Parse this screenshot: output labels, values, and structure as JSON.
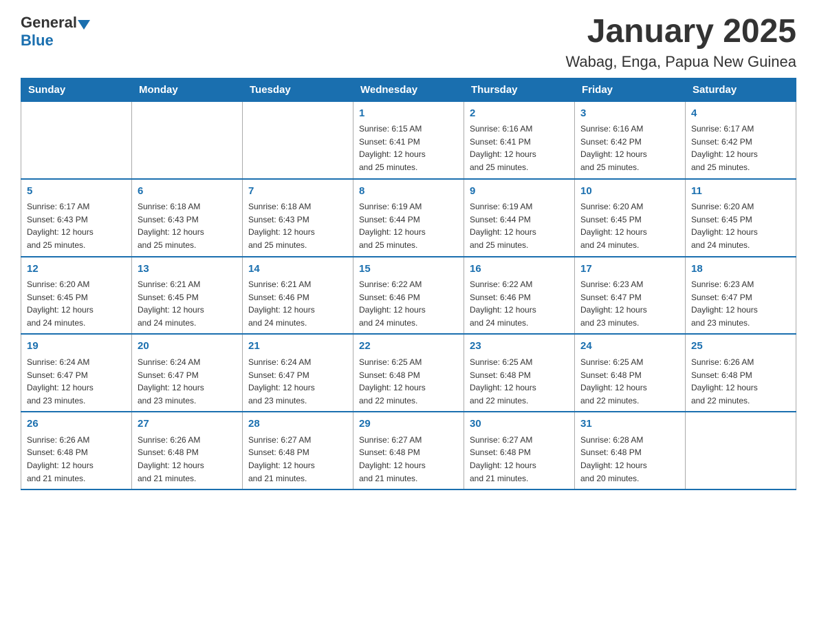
{
  "header": {
    "logo_general": "General",
    "logo_blue": "Blue",
    "month_title": "January 2025",
    "location": "Wabag, Enga, Papua New Guinea"
  },
  "weekdays": [
    "Sunday",
    "Monday",
    "Tuesday",
    "Wednesday",
    "Thursday",
    "Friday",
    "Saturday"
  ],
  "weeks": [
    [
      {
        "day": "",
        "info": ""
      },
      {
        "day": "",
        "info": ""
      },
      {
        "day": "",
        "info": ""
      },
      {
        "day": "1",
        "info": "Sunrise: 6:15 AM\nSunset: 6:41 PM\nDaylight: 12 hours\nand 25 minutes."
      },
      {
        "day": "2",
        "info": "Sunrise: 6:16 AM\nSunset: 6:41 PM\nDaylight: 12 hours\nand 25 minutes."
      },
      {
        "day": "3",
        "info": "Sunrise: 6:16 AM\nSunset: 6:42 PM\nDaylight: 12 hours\nand 25 minutes."
      },
      {
        "day": "4",
        "info": "Sunrise: 6:17 AM\nSunset: 6:42 PM\nDaylight: 12 hours\nand 25 minutes."
      }
    ],
    [
      {
        "day": "5",
        "info": "Sunrise: 6:17 AM\nSunset: 6:43 PM\nDaylight: 12 hours\nand 25 minutes."
      },
      {
        "day": "6",
        "info": "Sunrise: 6:18 AM\nSunset: 6:43 PM\nDaylight: 12 hours\nand 25 minutes."
      },
      {
        "day": "7",
        "info": "Sunrise: 6:18 AM\nSunset: 6:43 PM\nDaylight: 12 hours\nand 25 minutes."
      },
      {
        "day": "8",
        "info": "Sunrise: 6:19 AM\nSunset: 6:44 PM\nDaylight: 12 hours\nand 25 minutes."
      },
      {
        "day": "9",
        "info": "Sunrise: 6:19 AM\nSunset: 6:44 PM\nDaylight: 12 hours\nand 25 minutes."
      },
      {
        "day": "10",
        "info": "Sunrise: 6:20 AM\nSunset: 6:45 PM\nDaylight: 12 hours\nand 24 minutes."
      },
      {
        "day": "11",
        "info": "Sunrise: 6:20 AM\nSunset: 6:45 PM\nDaylight: 12 hours\nand 24 minutes."
      }
    ],
    [
      {
        "day": "12",
        "info": "Sunrise: 6:20 AM\nSunset: 6:45 PM\nDaylight: 12 hours\nand 24 minutes."
      },
      {
        "day": "13",
        "info": "Sunrise: 6:21 AM\nSunset: 6:45 PM\nDaylight: 12 hours\nand 24 minutes."
      },
      {
        "day": "14",
        "info": "Sunrise: 6:21 AM\nSunset: 6:46 PM\nDaylight: 12 hours\nand 24 minutes."
      },
      {
        "day": "15",
        "info": "Sunrise: 6:22 AM\nSunset: 6:46 PM\nDaylight: 12 hours\nand 24 minutes."
      },
      {
        "day": "16",
        "info": "Sunrise: 6:22 AM\nSunset: 6:46 PM\nDaylight: 12 hours\nand 24 minutes."
      },
      {
        "day": "17",
        "info": "Sunrise: 6:23 AM\nSunset: 6:47 PM\nDaylight: 12 hours\nand 23 minutes."
      },
      {
        "day": "18",
        "info": "Sunrise: 6:23 AM\nSunset: 6:47 PM\nDaylight: 12 hours\nand 23 minutes."
      }
    ],
    [
      {
        "day": "19",
        "info": "Sunrise: 6:24 AM\nSunset: 6:47 PM\nDaylight: 12 hours\nand 23 minutes."
      },
      {
        "day": "20",
        "info": "Sunrise: 6:24 AM\nSunset: 6:47 PM\nDaylight: 12 hours\nand 23 minutes."
      },
      {
        "day": "21",
        "info": "Sunrise: 6:24 AM\nSunset: 6:47 PM\nDaylight: 12 hours\nand 23 minutes."
      },
      {
        "day": "22",
        "info": "Sunrise: 6:25 AM\nSunset: 6:48 PM\nDaylight: 12 hours\nand 22 minutes."
      },
      {
        "day": "23",
        "info": "Sunrise: 6:25 AM\nSunset: 6:48 PM\nDaylight: 12 hours\nand 22 minutes."
      },
      {
        "day": "24",
        "info": "Sunrise: 6:25 AM\nSunset: 6:48 PM\nDaylight: 12 hours\nand 22 minutes."
      },
      {
        "day": "25",
        "info": "Sunrise: 6:26 AM\nSunset: 6:48 PM\nDaylight: 12 hours\nand 22 minutes."
      }
    ],
    [
      {
        "day": "26",
        "info": "Sunrise: 6:26 AM\nSunset: 6:48 PM\nDaylight: 12 hours\nand 21 minutes."
      },
      {
        "day": "27",
        "info": "Sunrise: 6:26 AM\nSunset: 6:48 PM\nDaylight: 12 hours\nand 21 minutes."
      },
      {
        "day": "28",
        "info": "Sunrise: 6:27 AM\nSunset: 6:48 PM\nDaylight: 12 hours\nand 21 minutes."
      },
      {
        "day": "29",
        "info": "Sunrise: 6:27 AM\nSunset: 6:48 PM\nDaylight: 12 hours\nand 21 minutes."
      },
      {
        "day": "30",
        "info": "Sunrise: 6:27 AM\nSunset: 6:48 PM\nDaylight: 12 hours\nand 21 minutes."
      },
      {
        "day": "31",
        "info": "Sunrise: 6:28 AM\nSunset: 6:48 PM\nDaylight: 12 hours\nand 20 minutes."
      },
      {
        "day": "",
        "info": ""
      }
    ]
  ]
}
